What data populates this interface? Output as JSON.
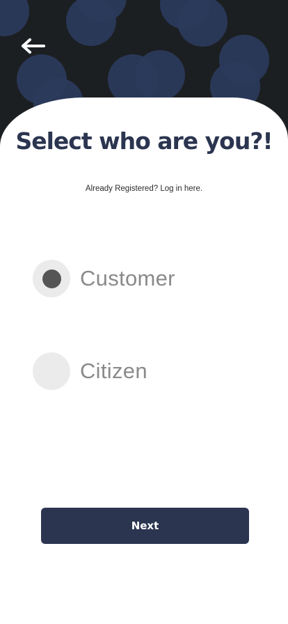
{
  "header": {
    "back_icon": "arrow-left-icon"
  },
  "main": {
    "title": "Select who are you?!",
    "subtitle": "Already Registered? Log in here."
  },
  "options": [
    {
      "label": "Customer",
      "selected": true
    },
    {
      "label": "Citizen",
      "selected": false
    }
  ],
  "footer": {
    "next_label": "Next"
  },
  "colors": {
    "header_bg": "#1c1f22",
    "bubble": "#2b3a5c",
    "accent": "#2b3550",
    "radio_bg": "#ebebeb",
    "radio_dot": "#555555",
    "option_text": "#8a8a8a"
  }
}
